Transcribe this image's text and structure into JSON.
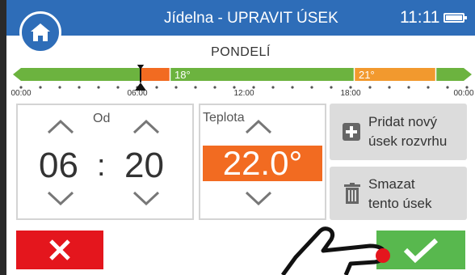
{
  "header": {
    "title": "Jídelna - UPRAVIT ÚSEK",
    "time": "11:11"
  },
  "day": "PONDELÍ",
  "timeline": {
    "segments": [
      {
        "label": "",
        "color": "#6cb33f"
      },
      {
        "label": "",
        "color": "#f26b21"
      },
      {
        "label": "18°",
        "color": "#6cb33f"
      },
      {
        "label": "21°",
        "color": "#f2992e"
      },
      {
        "label": "",
        "color": "#6cb33f"
      }
    ],
    "ticks": [
      "00:00",
      "06:00",
      "12:00",
      "18:00",
      "00:00"
    ],
    "marker": "06:20"
  },
  "od": {
    "label": "Od",
    "hours": "06",
    "separator": ":",
    "minutes": "20"
  },
  "temperature": {
    "label": "Teplota",
    "value": "22.0°"
  },
  "buttons": {
    "add_line1": "Pridat nový",
    "add_line2": "úsek rozvrhu",
    "delete_line1": "Smazat",
    "delete_line2": "tento úsek"
  },
  "colors": {
    "header": "#2e6db8",
    "accent": "#f26b21",
    "green": "#6cb33f",
    "cancel": "#e4161d",
    "confirm": "#58b84e"
  }
}
